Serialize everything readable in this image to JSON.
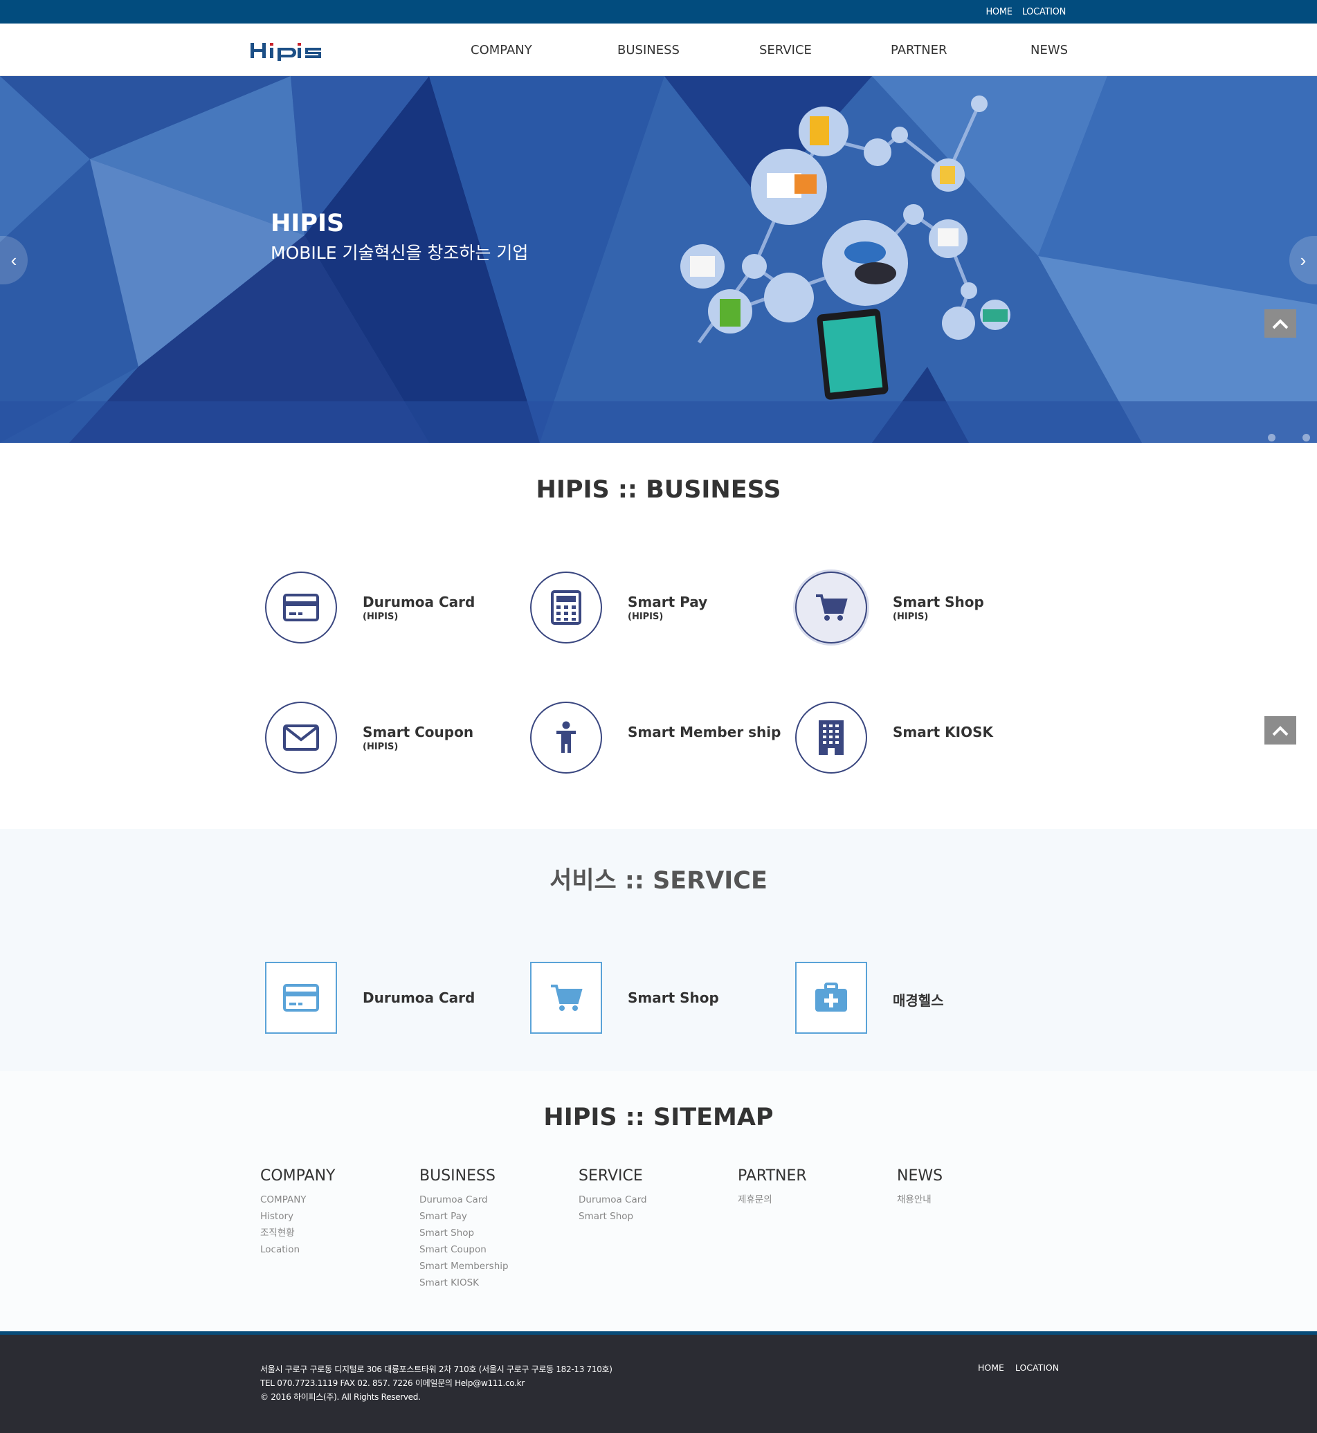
{
  "topbar": {
    "home": "HOME",
    "location": "LOCATION"
  },
  "header": {
    "logo_text": "HIPIS",
    "nav": [
      "COMPANY",
      "BUSINESS",
      "SERVICE",
      "PARTNER",
      "NEWS"
    ]
  },
  "hero": {
    "title": "HIPIS",
    "subtitle": "MOBILE 기술혁신을 창조하는 기업"
  },
  "business": {
    "title": "HIPIS :: BUSINESS",
    "items": [
      {
        "name": "Durumoa Card",
        "sub": "(HIPIS)",
        "icon": "credit-card-icon"
      },
      {
        "name": "Smart Pay",
        "sub": "(HIPIS)",
        "icon": "calculator-icon"
      },
      {
        "name": "Smart Shop",
        "sub": "(HIPIS)",
        "icon": "shopping-cart-icon"
      },
      {
        "name": "Smart Coupon",
        "sub": "(HIPIS)",
        "icon": "envelope-icon"
      },
      {
        "name": "Smart Member ship",
        "sub": "",
        "icon": "person-icon"
      },
      {
        "name": "Smart KIOSK",
        "sub": "",
        "icon": "building-icon"
      }
    ]
  },
  "service": {
    "title": "서비스 :: SERVICE",
    "items": [
      {
        "name": "Durumoa Card",
        "icon": "credit-card-icon"
      },
      {
        "name": "Smart Shop",
        "icon": "shopping-cart-icon"
      },
      {
        "name": "매경헬스",
        "icon": "medical-kit-icon"
      }
    ]
  },
  "sitemap": {
    "title": "HIPIS :: SITEMAP",
    "columns": [
      {
        "head": "COMPANY",
        "links": [
          "COMPANY",
          "History",
          "조직현황",
          "Location"
        ]
      },
      {
        "head": "BUSINESS",
        "links": [
          "Durumoa Card",
          "Smart Pay",
          "Smart Shop",
          "Smart Coupon",
          "Smart Membership",
          "Smart KIOSK"
        ]
      },
      {
        "head": "SERVICE",
        "links": [
          "Durumoa Card",
          "Smart Shop"
        ]
      },
      {
        "head": "PARTNER",
        "links": [
          "제휴문의"
        ]
      },
      {
        "head": "NEWS",
        "links": [
          "채용안내"
        ]
      }
    ]
  },
  "footer": {
    "address": "서울시 구로구 구로동 디지털로 306 대륭포스트타워 2차 710호 (서울시 구로구 구로동 182-13 710호)",
    "contact": "TEL 070.7723.1119 FAX 02. 857. 7226 이메일문의 Help@w111.co.kr",
    "copyright": "© 2016 하이피스(주). All Rights Reserved.",
    "home": "HOME",
    "location": "LOCATION"
  },
  "colors": {
    "topbar": "#024c7e",
    "accent": "#3a4780",
    "service_border": "#5aa3d8",
    "footer": "#2b2c33"
  }
}
